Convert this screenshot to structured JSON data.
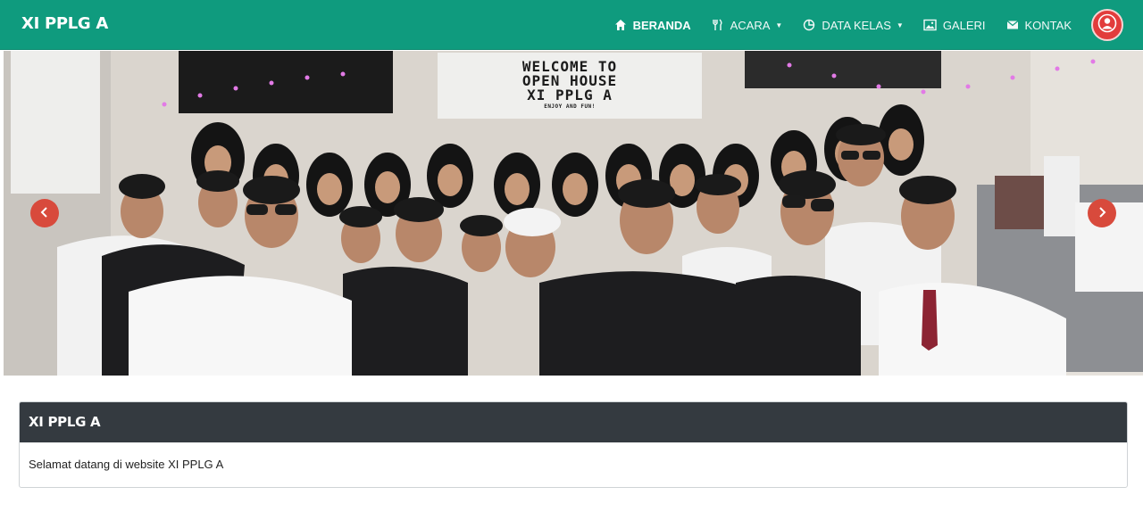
{
  "brand": "XI PPLG A",
  "nav": {
    "items": [
      {
        "label": "BERANDA",
        "icon": "home-icon",
        "dropdown": false
      },
      {
        "label": "ACARA",
        "icon": "utensils-icon",
        "dropdown": true
      },
      {
        "label": "DATA KELAS",
        "icon": "pie-chart-icon",
        "dropdown": true
      },
      {
        "label": "GALERI",
        "icon": "image-icon",
        "dropdown": false
      },
      {
        "label": "KONTAK",
        "icon": "mail-icon",
        "dropdown": false
      }
    ],
    "avatar_icon": "user-icon"
  },
  "hero": {
    "sign_line1": "WELCOME TO",
    "sign_line2": "OPEN HOUSE",
    "sign_line3": "XI PPLG A",
    "sign_small": "ENJOY AND FUN!",
    "prev_icon": "chevron-left-icon",
    "next_icon": "chevron-right-icon"
  },
  "card": {
    "title": "XI PPLG A",
    "body": "Selamat datang di website XI PPLG A"
  },
  "colors": {
    "navbar": "#0f9b7e",
    "card_header": "#343a40",
    "accent_red": "#d84a3c"
  }
}
